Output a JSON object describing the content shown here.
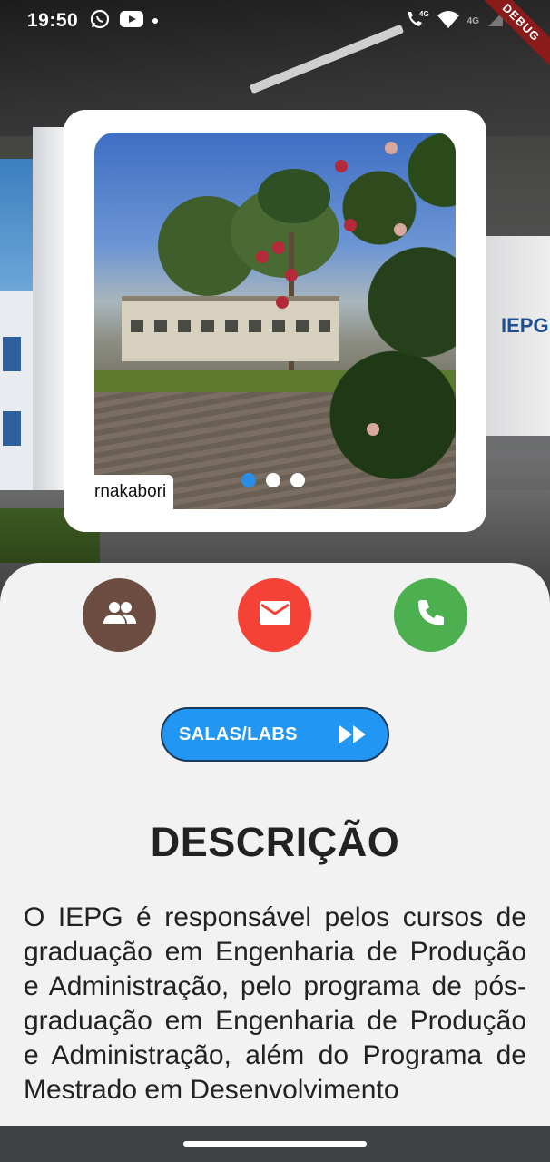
{
  "status_bar": {
    "time": "19:50",
    "network_label": "4G",
    "icons": [
      "whatsapp-icon",
      "youtube-icon",
      "notification-dot",
      "call-4g-icon",
      "wifi-icon",
      "signal-icon",
      "battery-icon"
    ]
  },
  "debug_banner": "DEBUG",
  "carousel": {
    "photo_credit": "rnakabori",
    "page_count": 3,
    "active_index": 0,
    "indicator_active_color": "#2a8de6"
  },
  "actions": {
    "people_icon": "group-icon",
    "people_color": "#6d4c41",
    "mail_icon": "email-icon",
    "mail_color": "#f44336",
    "phone_icon": "phone-icon",
    "phone_color": "#4caf50"
  },
  "salas_button": {
    "label": "SALAS/LABS",
    "icon": "fast-forward-icon",
    "color": "#2196f3"
  },
  "description": {
    "title": "DESCRIÇÃO",
    "text": "O IEPG é responsável pelos cursos de graduação em Engenharia de Produção e Administração, pelo programa de pós-graduação em Engenharia de Produção e Administração, além do Programa de Mestrado em Desenvolvimento"
  }
}
